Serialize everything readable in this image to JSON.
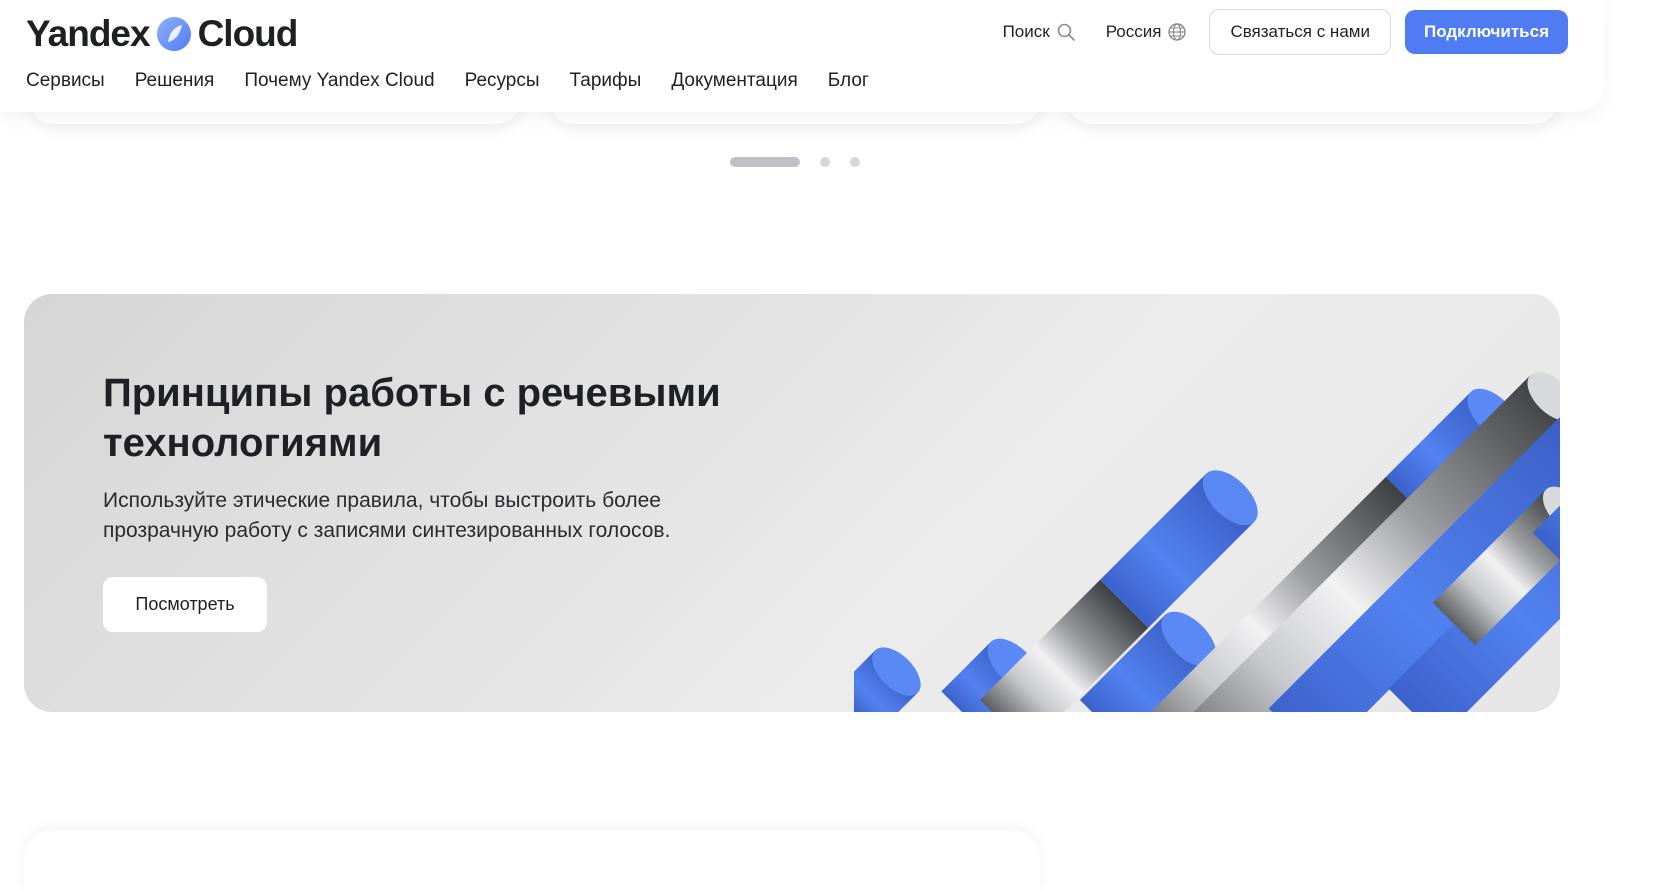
{
  "header": {
    "logo_left": "Yandex",
    "logo_right": "Cloud",
    "search_label": "Поиск",
    "region_label": "Россия",
    "contact_label": "Связаться с нами",
    "connect_label": "Подключиться"
  },
  "nav": {
    "items": [
      {
        "label": "Сервисы"
      },
      {
        "label": "Решения"
      },
      {
        "label": "Почему Yandex Cloud"
      },
      {
        "label": "Ресурсы"
      },
      {
        "label": "Тарифы"
      },
      {
        "label": "Документация"
      },
      {
        "label": "Блог"
      }
    ]
  },
  "carousel": {
    "page_count": 3,
    "active_page": 1
  },
  "banner": {
    "title": "Принципы работы с речевыми технологиями",
    "text": "Используйте этические правила, чтобы выстроить более прозрачную работу с записями синтезированных голосов.",
    "button_label": "Посмотреть",
    "image": "blue-and-steel-cylinders-illustration"
  },
  "icons": {
    "search": "search-icon",
    "region": "globe-icon"
  },
  "colors": {
    "accent": "#4f7cf2",
    "cylinder_blue": "#4a74e0",
    "banner_bg": "#e3e3e3",
    "text": "#1f2023"
  }
}
